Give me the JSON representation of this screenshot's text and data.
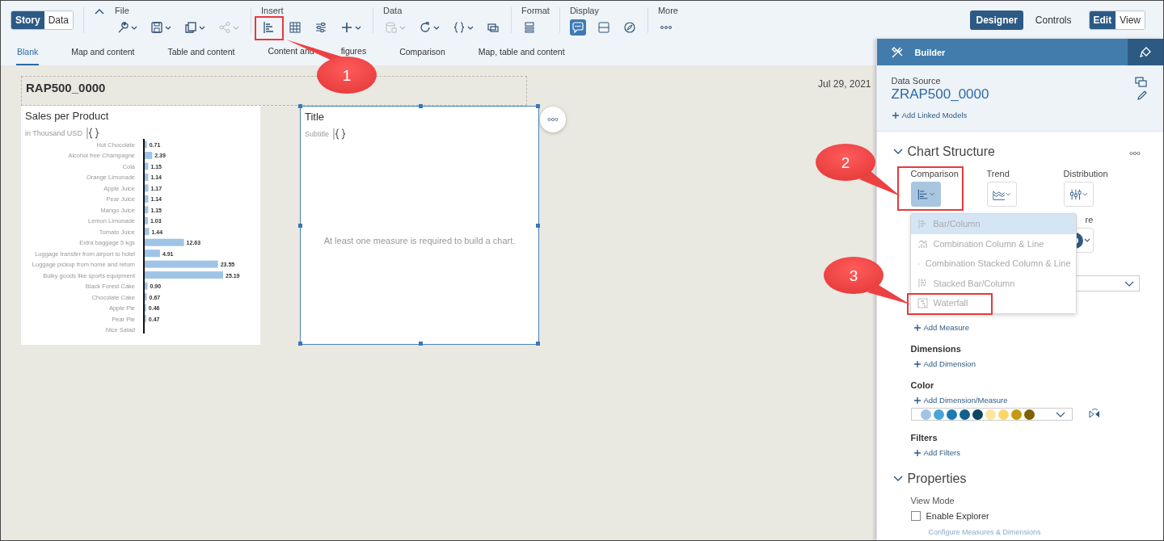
{
  "toolbar": {
    "view_switch": [
      {
        "label": "Story",
        "selected": true
      },
      {
        "label": "Data",
        "selected": false
      }
    ],
    "groups": [
      {
        "label": "File",
        "tools": [
          {
            "kind": "wrench",
            "caret": true,
            "disabled": false,
            "selected": false
          },
          {
            "kind": "save",
            "caret": true,
            "disabled": false,
            "selected": false
          },
          {
            "kind": "copy",
            "caret": true,
            "disabled": false,
            "selected": false
          },
          {
            "kind": "share",
            "caret": true,
            "disabled": true,
            "selected": false
          }
        ]
      },
      {
        "label": "Insert",
        "tools": [
          {
            "kind": "chart",
            "caret": false,
            "disabled": false,
            "selected": false
          },
          {
            "kind": "table",
            "caret": false,
            "disabled": false,
            "selected": false
          },
          {
            "kind": "sliders",
            "caret": false,
            "disabled": false,
            "selected": false
          },
          {
            "kind": "plus",
            "caret": true,
            "disabled": false,
            "selected": false
          }
        ]
      },
      {
        "label": "Data",
        "tools": [
          {
            "kind": "database",
            "caret": true,
            "disabled": true,
            "selected": false
          },
          {
            "kind": "refresh",
            "caret": true,
            "disabled": false,
            "selected": false
          },
          {
            "kind": "braces",
            "caret": true,
            "disabled": false,
            "selected": false
          },
          {
            "kind": "link",
            "caret": false,
            "disabled": false,
            "selected": false
          }
        ]
      },
      {
        "label": "Format",
        "tools": [
          {
            "kind": "layout",
            "caret": false,
            "disabled": false,
            "selected": false
          }
        ]
      },
      {
        "label": "Display",
        "tools": [
          {
            "kind": "comment",
            "caret": false,
            "disabled": false,
            "selected": true
          },
          {
            "kind": "panel",
            "caret": false,
            "disabled": false,
            "selected": false
          },
          {
            "kind": "compass",
            "caret": false,
            "disabled": false,
            "selected": false
          }
        ]
      },
      {
        "label": "More",
        "tools": [
          {
            "kind": "more",
            "caret": false,
            "disabled": false,
            "selected": false
          }
        ]
      }
    ],
    "mode_tabs": [
      {
        "label": "Designer",
        "selected": true
      },
      {
        "label": "Controls",
        "selected": false
      }
    ],
    "edit_view": [
      {
        "label": "Edit",
        "selected": true
      },
      {
        "label": "View",
        "selected": false
      }
    ]
  },
  "templates": [
    {
      "label": "Blank",
      "selected": true
    },
    {
      "label": "Map and content",
      "selected": false
    },
    {
      "label": "Table and content",
      "selected": false
    },
    {
      "label": "Content and",
      "label_end": "figures",
      "selected": false
    },
    {
      "label": "Comparison",
      "selected": false
    },
    {
      "label": "Map, table and content",
      "selected": false
    }
  ],
  "story": {
    "title": "RAP500_0000",
    "date": "Jul 29, 2021",
    "widgets": [
      {
        "kind": "chart",
        "title": "Sales per Product",
        "subtitle": "in Thousand USD",
        "selected": false,
        "chart_data": {
          "type": "bar",
          "orientation": "horizontal",
          "data_labels": true,
          "categories": [
            "Hot Chocolate",
            "Alcohol free Champagne",
            "Cola",
            "Orange Limonade",
            "Apple Juice",
            "Pear Juice",
            "Mango Juice",
            "Lemon Limonade",
            "Tomato Juice",
            "Extra baggage 5 kgs",
            "Luggage transfer from airport to hotel",
            "Luggage pickup from home and return",
            "Bulky goods like sports equipment",
            "Black Forest Cake",
            "Chocolate Cake",
            "Apple Pie",
            "Pear Pie",
            "Nice Salad"
          ],
          "values": [
            0.71,
            2.39,
            1.15,
            1.14,
            1.17,
            1.14,
            1.15,
            1.03,
            1.44,
            12.63,
            4.91,
            23.55,
            25.19,
            0.9,
            0.67,
            0.46,
            0.47,
            null
          ],
          "value_labels": [
            "0.71",
            "2.39",
            "1.15",
            "1.14",
            "1.17",
            "1.14",
            "1.15",
            "1.03",
            "1.44",
            "12.63",
            "4.91",
            "23.55",
            "25.19",
            "0.90",
            "0.67",
            "0.46",
            "0.47",
            null
          ]
        }
      },
      {
        "kind": "empty",
        "title": "Title",
        "subtitle": "Subtitle",
        "message": "At least one measure is required to build a chart.",
        "selected": true
      }
    ]
  },
  "builder": {
    "title": "Builder",
    "data_source": {
      "label": "Data Source",
      "name": "ZRAP500_0000",
      "link": "Add Linked Models"
    },
    "chart_structure": {
      "title": "Chart Structure",
      "expanded": true,
      "types": [
        {
          "label": "Comparison",
          "kind": "bars",
          "selected": true
        },
        {
          "label": "Trend",
          "kind": "area",
          "selected": false
        },
        {
          "label": "Distribution",
          "kind": "boxplot",
          "selected": false
        },
        {
          "label": "re",
          "kind": "donut",
          "selected": false
        }
      ],
      "menu": [
        {
          "label": "Bar/Column",
          "kind": "bar",
          "selected": true
        },
        {
          "label": "Combination Column & Line",
          "kind": "combo",
          "selected": false
        },
        {
          "label": "Combination Stacked Column & Line",
          "kind": "combo",
          "selected": false
        },
        {
          "label": "Stacked Bar/Column",
          "kind": "stacked",
          "selected": false
        },
        {
          "label": "Waterfall",
          "kind": "waterfall",
          "selected": false
        }
      ],
      "add_measure": "Add Measure",
      "dimensions": {
        "label": "Dimensions",
        "link": "Add Dimension"
      },
      "color": {
        "label": "Color",
        "link": "Add Dimension/Measure",
        "palette": [
          {
            "color": "#9fc4e6"
          },
          {
            "color": "#4aa3d9"
          },
          {
            "color": "#1c7ab2"
          },
          {
            "color": "#13608f"
          },
          {
            "color": "#0e4464"
          },
          {
            "color": "#fde6a0"
          },
          {
            "color": "#fdd66a"
          },
          {
            "color": "#c49a12"
          },
          {
            "color": "#7f6102"
          }
        ]
      },
      "filters": {
        "label": "Filters",
        "link": "Add Filters"
      }
    },
    "properties": {
      "title": "Properties",
      "expanded": true,
      "view_mode": "View Mode",
      "option": {
        "label": "Enable Explorer",
        "checked": false
      },
      "link": "Configure Measures & Dimensions"
    }
  },
  "callouts": [
    {
      "number": "1"
    },
    {
      "number": "2"
    },
    {
      "number": "3"
    }
  ]
}
